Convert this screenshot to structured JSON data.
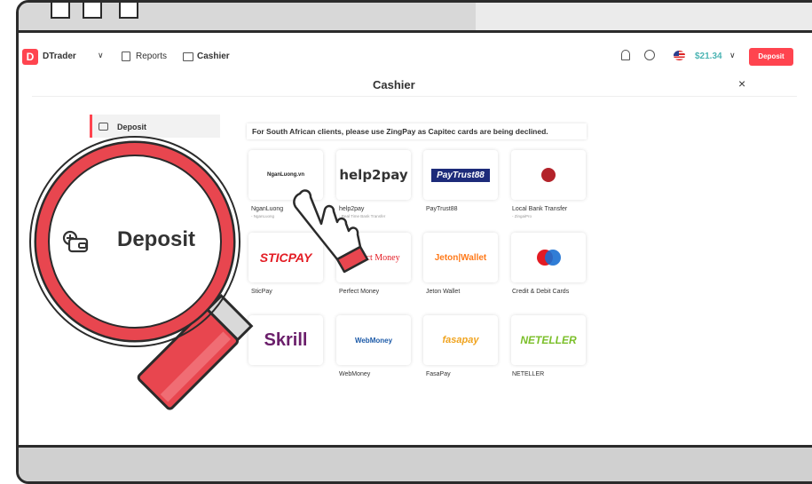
{
  "nav": {
    "logo_letter": "D",
    "dtrader": "DTrader",
    "reports": "Reports",
    "cashier": "Cashier",
    "balance": "$21.34",
    "deposit_button": "Deposit"
  },
  "page": {
    "title": "Cashier",
    "close": "×"
  },
  "sidebar": {
    "items": [
      {
        "label": "Deposit"
      }
    ]
  },
  "notice": "For South African clients, please use ZingPay as Capitec cards are being declined.",
  "methods": [
    {
      "name": "NganLuong",
      "sub": "- NganLuong",
      "logo_text": "NganLuong.vn"
    },
    {
      "name": "help2pay",
      "sub": "- Real Time Bank Transfer",
      "logo_text": "help2pay"
    },
    {
      "name": "PayTrust88",
      "sub": "",
      "logo_text": "PayTrust88"
    },
    {
      "name": "Local Bank Transfer",
      "sub": "- ZingaiPro",
      "logo_text": ""
    },
    {
      "name": "SticPay",
      "sub": "",
      "logo_text": "STICPAY"
    },
    {
      "name": "Perfect Money",
      "sub": "",
      "logo_text": "Perfect Money"
    },
    {
      "name": "Jeton Wallet",
      "sub": "",
      "logo_text": "Jeton|Wallet"
    },
    {
      "name": "Credit & Debit Cards",
      "sub": "",
      "logo_text": "maestro"
    },
    {
      "name": "Skrill",
      "sub": "",
      "logo_text": "Skrill"
    },
    {
      "name": "WebMoney",
      "sub": "",
      "logo_text": "WebMoney"
    },
    {
      "name": "FasaPay",
      "sub": "",
      "logo_text": "fasapay"
    },
    {
      "name": "NETELLER",
      "sub": "",
      "logo_text": "NETELLER"
    }
  ],
  "magnifier": {
    "label": "Deposit"
  },
  "colors": {
    "accent": "#ff444f",
    "balance": "#4bb4b3",
    "magnifier_ring": "#e8464f"
  }
}
